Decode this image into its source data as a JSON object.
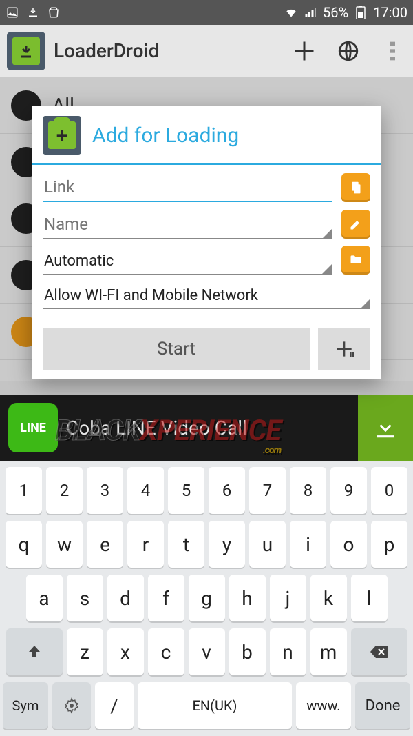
{
  "status": {
    "battery": "56%",
    "time": "17:00"
  },
  "appbar": {
    "title": "LoaderDroid"
  },
  "bg": {
    "tab_all": "All"
  },
  "dialog": {
    "title": "Add for Loading",
    "link_placeholder": "Link",
    "name_placeholder": "Name",
    "path_value": "Automatic",
    "network_value": "Allow WI-FI and Mobile Network",
    "start_label": "Start"
  },
  "ad": {
    "brand": "LINE",
    "text": "Coba LINE Video Call"
  },
  "watermark": {
    "black": "BLACK",
    "xp": "XPERIENCE",
    "com": ".com"
  },
  "keyboard": {
    "row1": [
      "1",
      "2",
      "3",
      "4",
      "5",
      "6",
      "7",
      "8",
      "9",
      "0"
    ],
    "row2": [
      "q",
      "w",
      "e",
      "r",
      "t",
      "y",
      "u",
      "i",
      "o",
      "p"
    ],
    "row3": [
      "a",
      "s",
      "d",
      "f",
      "g",
      "h",
      "j",
      "k",
      "l"
    ],
    "row4_mid": [
      "z",
      "x",
      "c",
      "v",
      "b",
      "n",
      "m"
    ],
    "sym": "Sym",
    "slash": "/",
    "space": "EN(UK)",
    "www": "www.",
    "done": "Done"
  }
}
